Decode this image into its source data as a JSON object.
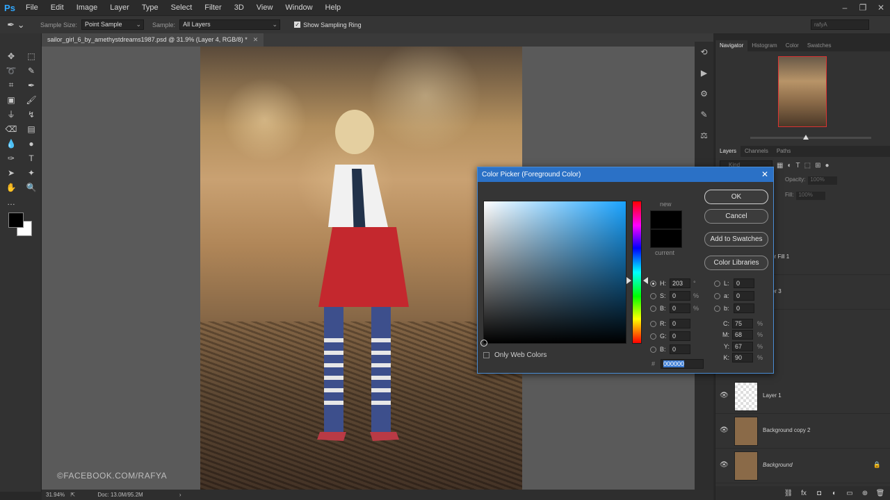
{
  "app": {
    "logo": "Ps"
  },
  "menu": [
    "File",
    "Edit",
    "Image",
    "Layer",
    "Type",
    "Select",
    "Filter",
    "3D",
    "View",
    "Window",
    "Help"
  ],
  "window_controls": [
    "–",
    "❐",
    "✕"
  ],
  "options_bar": {
    "tool_icon": "eyedropper-icon",
    "sample_size_label": "Sample Size:",
    "sample_size_value": "Point Sample",
    "sample_label": "Sample:",
    "sample_value": "All Layers",
    "sampling_ring_label": "Show Sampling Ring",
    "sampling_ring_checked": true,
    "user_field": "rafyA"
  },
  "document": {
    "tab_title": "sailor_girl_6_by_amethystdreams1987.psd @ 31.9% (Layer 4, RGB/8) *",
    "watermark": "©FACEBOOK.COM/RAFYA",
    "zoom": "31.94%",
    "doc_size": "Doc: 13.0M/95.2M"
  },
  "right_panel": {
    "top_tabs": [
      "Navigator",
      "Histogram",
      "Color",
      "Swatches"
    ],
    "layers_tabs": [
      "Layers",
      "Channels",
      "Paths"
    ],
    "kind_placeholder": "Kind",
    "opacity_label": "Opacity:",
    "opacity_value": "100%",
    "fill_label": "Fill:",
    "fill_value": "100%",
    "layers": [
      {
        "name": "Color Fill 1"
      },
      {
        "name": "Layer 3"
      },
      {
        "name": "Layer 1"
      },
      {
        "name": "Background copy 2"
      },
      {
        "name": "Background"
      }
    ]
  },
  "color_picker": {
    "title": "Color Picker (Foreground Color)",
    "new_label": "new",
    "current_label": "current",
    "buttons": {
      "ok": "OK",
      "cancel": "Cancel",
      "add_to_swatches": "Add to Swatches",
      "color_libraries": "Color Libraries"
    },
    "hue_fraction": 0.56,
    "fields": {
      "H": {
        "value": "203",
        "unit": "°"
      },
      "S": {
        "value": "0",
        "unit": "%"
      },
      "B": {
        "value": "0",
        "unit": "%"
      },
      "R": {
        "value": "0",
        "unit": ""
      },
      "G": {
        "value": "0",
        "unit": ""
      },
      "Bl": {
        "value": "0",
        "unit": ""
      },
      "L": {
        "value": "0"
      },
      "a": {
        "value": "0"
      },
      "b": {
        "value": "0"
      },
      "C": {
        "value": "75",
        "unit": "%"
      },
      "M": {
        "value": "68",
        "unit": "%"
      },
      "Y": {
        "value": "67",
        "unit": "%"
      },
      "K": {
        "value": "90",
        "unit": "%"
      }
    },
    "field_labels": {
      "H": "H:",
      "S": "S:",
      "B": "B:",
      "R": "R:",
      "G": "G:",
      "Bl": "B:",
      "L": "L:",
      "a": "a:",
      "b": "b:",
      "C": "C:",
      "M": "M:",
      "Y": "Y:",
      "K": "K:"
    },
    "only_web_colors_label": "Only Web Colors",
    "hex_label": "#",
    "hex_value": "000000",
    "colors": {
      "new": "#000000",
      "current": "#000000",
      "hue": "#1aa3ff"
    }
  }
}
